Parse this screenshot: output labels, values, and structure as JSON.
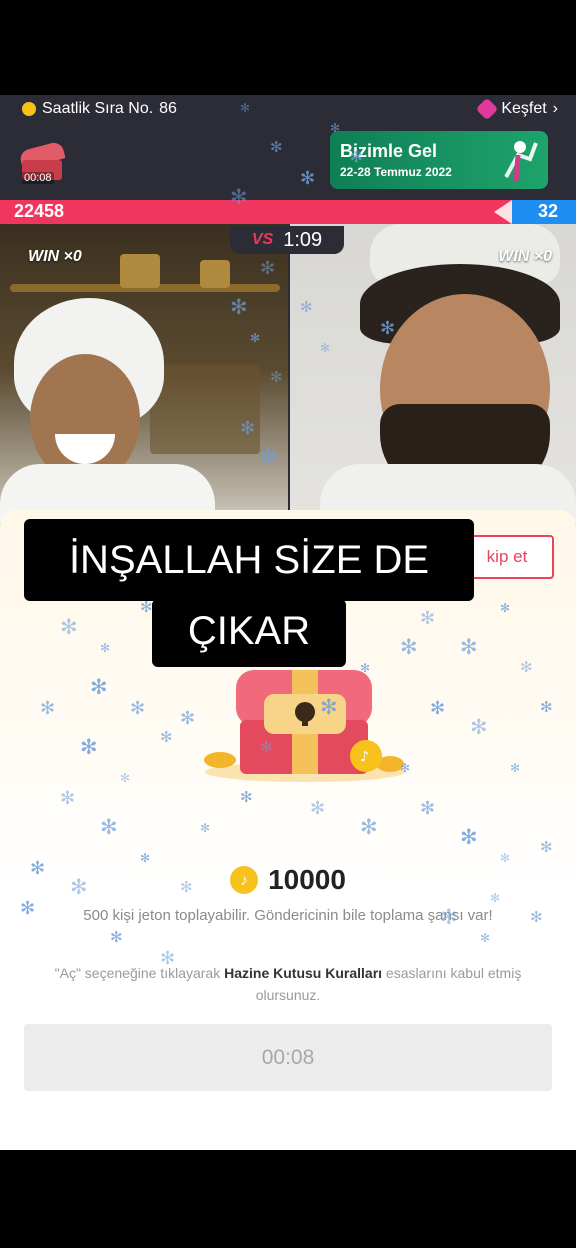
{
  "header": {
    "rank_label": "Saatlik Sıra No.",
    "rank_number": "86",
    "explore_label": "Keşfet",
    "explore_chevron": "›"
  },
  "mini_chest": {
    "timer": "00:08"
  },
  "promo_banner": {
    "title": "Bizimle Gel",
    "dates": "22-28 Temmuz 2022"
  },
  "battle": {
    "score_left": "22458",
    "score_right": "32",
    "vs_label": "VS",
    "timer": "1:09",
    "win_left": "WIN ×0",
    "win_right": "WIN ×0",
    "colors": {
      "left": "#f0355e",
      "right": "#1e8ef2"
    }
  },
  "captions": {
    "line1": "İNŞALLAH SİZE DE",
    "line2": "ÇIKAR"
  },
  "treasure": {
    "skip_label": "kip et",
    "prize_amount": "10000",
    "description": "500 kişi jeton toplayabilir. Göndericinin bile toplama şansı var!",
    "rules_prefix": "\"Aç\" seçeneğine tıklayarak ",
    "rules_link": "Hazine Kutusu Kuralları",
    "rules_suffix": " esaslarını kabul etmiş olursunuz.",
    "countdown": "00:08"
  }
}
